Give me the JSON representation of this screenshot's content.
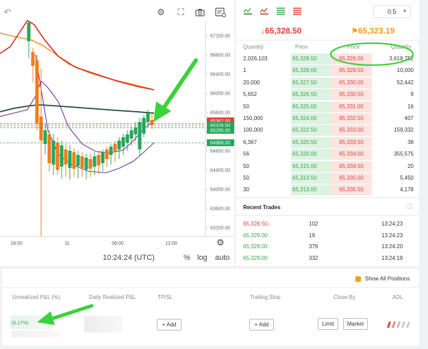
{
  "chart": {
    "y_ticks": [
      "67200.00",
      "66800.00",
      "66400.00",
      "66000.00",
      "65600.00",
      "65200.00",
      "64800.00",
      "64400.00",
      "64000.00",
      "63600.00",
      "63200.00"
    ],
    "x_ticks": [
      "18:00",
      "11",
      "06:00",
      "12:00"
    ],
    "price_tags": [
      {
        "text": "65367.00",
        "bg": "#e0403a"
      },
      {
        "text": "65328.50",
        "bg": "#26a65b"
      },
      {
        "text": "65285.00",
        "bg": "#26a65b"
      },
      {
        "text": "64968.00",
        "bg": "#26a65b"
      }
    ],
    "time_label": "10:24:24 (UTC)",
    "pct_label": "%",
    "log_label": "log",
    "auto_label": "auto"
  },
  "orderbook": {
    "last_price": "↓65,328.50",
    "mark_price": "65,323.19",
    "precision": "0.5",
    "headers": {
      "quantity": "Quantity",
      "price": "Price",
      "price2": "Price",
      "quantity2": "Quantity"
    },
    "rows": [
      {
        "bid_qty": "2,026,103",
        "bid_price": "65,328.50",
        "ask_price": "65,329.00",
        "ask_qty": "3,618,752"
      },
      {
        "bid_qty": "1",
        "bid_price": "65,328.00",
        "ask_price": "65,329.50",
        "ask_qty": "10,000"
      },
      {
        "bid_qty": "20,000",
        "bid_price": "65,327.50",
        "ask_price": "65,330.00",
        "ask_qty": "52,442"
      },
      {
        "bid_qty": "5,652",
        "bid_price": "65,326.50",
        "ask_price": "65,330.50",
        "ask_qty": "9"
      },
      {
        "bid_qty": "50",
        "bid_price": "65,325.00",
        "ask_price": "65,331.00",
        "ask_qty": "16"
      },
      {
        "bid_qty": "150,000",
        "bid_price": "65,324.00",
        "ask_price": "65,332.50",
        "ask_qty": "407"
      },
      {
        "bid_qty": "100,000",
        "bid_price": "65,322.50",
        "ask_price": "65,333.00",
        "ask_qty": "159,332"
      },
      {
        "bid_qty": "6,367",
        "bid_price": "65,320.50",
        "ask_price": "65,333.50",
        "ask_qty": "38"
      },
      {
        "bid_qty": "56",
        "bid_price": "65,320.00",
        "ask_price": "65,334.00",
        "ask_qty": "355,575"
      },
      {
        "bid_qty": "50",
        "bid_price": "65,315.00",
        "ask_price": "65,334.50",
        "ask_qty": "20"
      },
      {
        "bid_qty": "50",
        "bid_price": "65,313.50",
        "ask_price": "65,335.00",
        "ask_qty": "5,450"
      },
      {
        "bid_qty": "30",
        "bid_price": "65,313.00",
        "ask_price": "65,335.50",
        "ask_qty": "4,178"
      }
    ],
    "recent_trades_title": "Recent Trades",
    "trades": [
      {
        "price": "65,328.50↓",
        "qty": "102",
        "time": "13:24:23",
        "color": "#e0403a"
      },
      {
        "price": "65,329.00",
        "qty": "19",
        "time": "13:24:23",
        "color": "#35a54f"
      },
      {
        "price": "65,329.00",
        "qty": "379",
        "time": "13:24:20",
        "color": "#35a54f"
      },
      {
        "price": "65,329.00",
        "qty": "332",
        "time": "13:24:19",
        "color": "#35a54f"
      }
    ]
  },
  "positions": {
    "show_all": "Show All Positions",
    "headers": {
      "unrealized": "Unrealized P&L (%)",
      "daily": "Daily Realized P&L",
      "tpsl": "TP/SL",
      "trailing": "Trailing Stop",
      "close_by": "Close By",
      "adl": "ADL"
    },
    "unrealized_value": "(6.17%)",
    "add_tpsl": "Add",
    "add_trailing": "Add",
    "limit": "Limit",
    "market": "Market"
  },
  "colors": {
    "green": "#26a65b",
    "red": "#e0403a",
    "orange": "#f0a020",
    "annot": "#3bd23b"
  }
}
